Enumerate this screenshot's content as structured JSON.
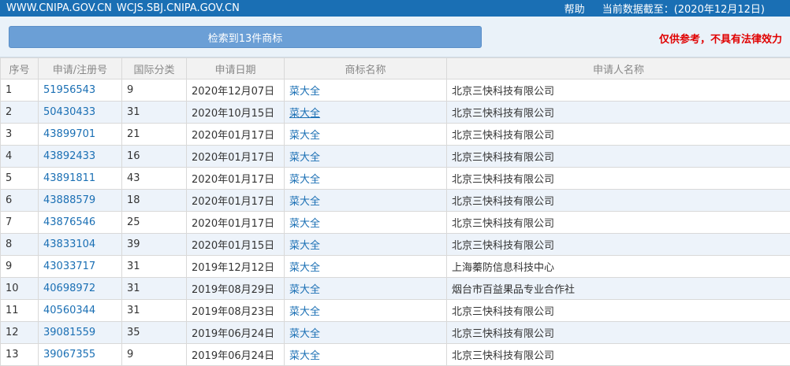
{
  "topbar": {
    "site1": "WWW.CNIPA.GOV.CN",
    "site2": "WCJS.SBJ.CNIPA.GOV.CN",
    "help": "帮助",
    "data_date": "当前数据截至：(2020年12月12日)"
  },
  "panel": {
    "result_label": "检索到13件商标",
    "disclaimer": "仅供参考，不具有法律效力"
  },
  "table": {
    "headers": [
      "序号",
      "申请/注册号",
      "国际分类",
      "申请日期",
      "商标名称",
      "申请人名称"
    ],
    "rows": [
      {
        "no": "1",
        "reg": "51956543",
        "cls": "9",
        "date": "2020年12月07日",
        "mark": "菜大全",
        "applicant": "北京三快科技有限公司"
      },
      {
        "no": "2",
        "reg": "50430433",
        "cls": "31",
        "date": "2020年10月15日",
        "mark": "菜大全",
        "applicant": "北京三快科技有限公司"
      },
      {
        "no": "3",
        "reg": "43899701",
        "cls": "21",
        "date": "2020年01月17日",
        "mark": "菜大全",
        "applicant": "北京三快科技有限公司"
      },
      {
        "no": "4",
        "reg": "43892433",
        "cls": "16",
        "date": "2020年01月17日",
        "mark": "菜大全",
        "applicant": "北京三快科技有限公司"
      },
      {
        "no": "5",
        "reg": "43891811",
        "cls": "43",
        "date": "2020年01月17日",
        "mark": "菜大全",
        "applicant": "北京三快科技有限公司"
      },
      {
        "no": "6",
        "reg": "43888579",
        "cls": "18",
        "date": "2020年01月17日",
        "mark": "菜大全",
        "applicant": "北京三快科技有限公司"
      },
      {
        "no": "7",
        "reg": "43876546",
        "cls": "25",
        "date": "2020年01月17日",
        "mark": "菜大全",
        "applicant": "北京三快科技有限公司"
      },
      {
        "no": "8",
        "reg": "43833104",
        "cls": "39",
        "date": "2020年01月15日",
        "mark": "菜大全",
        "applicant": "北京三快科技有限公司"
      },
      {
        "no": "9",
        "reg": "43033717",
        "cls": "31",
        "date": "2019年12月12日",
        "mark": "菜大全",
        "applicant": "上海蓁防信息科技中心"
      },
      {
        "no": "10",
        "reg": "40698972",
        "cls": "31",
        "date": "2019年08月29日",
        "mark": "菜大全",
        "applicant": "烟台市百益果品专业合作社"
      },
      {
        "no": "11",
        "reg": "40560344",
        "cls": "31",
        "date": "2019年08月23日",
        "mark": "菜大全",
        "applicant": "北京三快科技有限公司"
      },
      {
        "no": "12",
        "reg": "39081559",
        "cls": "35",
        "date": "2019年06月24日",
        "mark": "菜大全",
        "applicant": "北京三快科技有限公司"
      },
      {
        "no": "13",
        "reg": "39067355",
        "cls": "9",
        "date": "2019年06月24日",
        "mark": "菜大全",
        "applicant": "北京三快科技有限公司"
      }
    ]
  }
}
